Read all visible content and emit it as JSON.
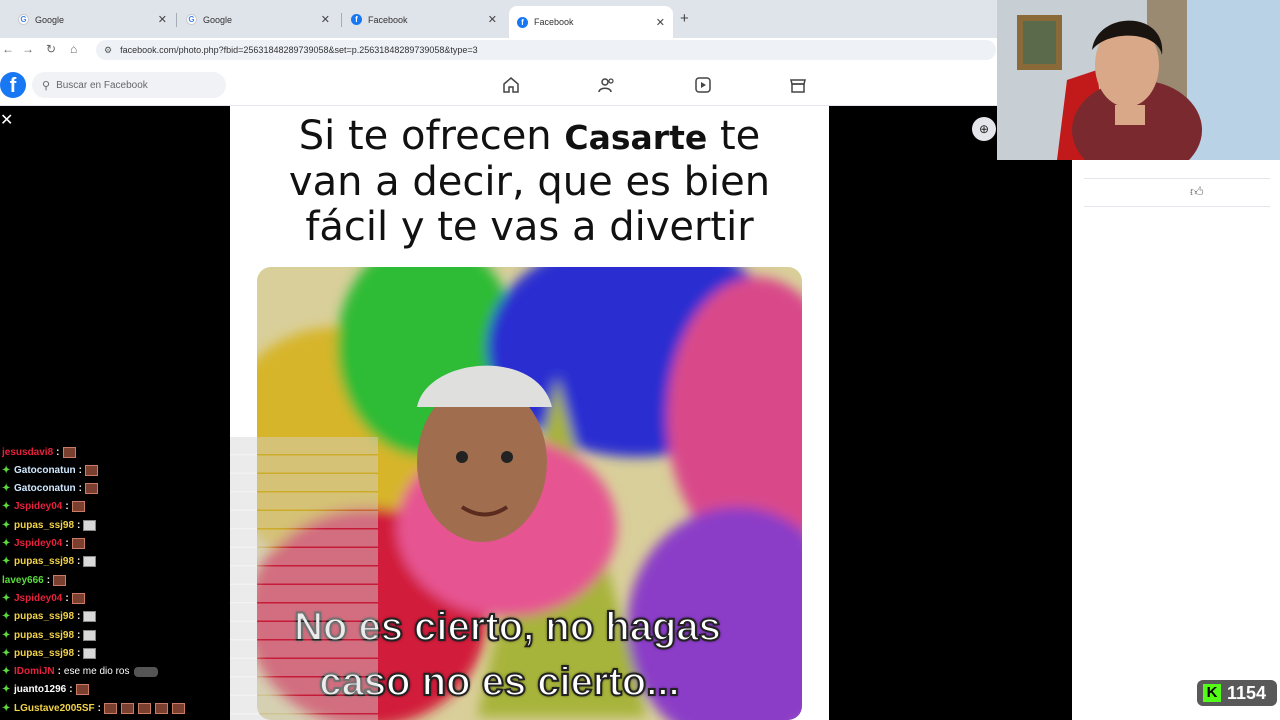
{
  "browser": {
    "tabs": [
      {
        "label": "Google",
        "favicon": "google-icon"
      },
      {
        "label": "Google",
        "favicon": "google-icon"
      },
      {
        "label": "Facebook",
        "favicon": "facebook-icon"
      },
      {
        "label": "Facebook",
        "favicon": "facebook-icon",
        "active": true
      }
    ],
    "url": "facebook.com/photo.php?fbid=2563184828973905​8&set=p.25631848289739058&type=3"
  },
  "facebook": {
    "logo": "f",
    "search_placeholder": "Buscar en Facebook",
    "nav_icons": [
      "home-icon",
      "friends-icon",
      "video-icon",
      "marketplace-icon"
    ]
  },
  "meme": {
    "caption_part1": "Si te ofrecen",
    "caption_bold": "Casarte",
    "caption_part2": "te",
    "caption_line2": "van a decir, que es bien",
    "caption_line3": "fácil y te vas a divertir",
    "subtitle_line1": "No es cierto, no hagas",
    "subtitle_line2": "caso no es cierto..."
  },
  "chat": {
    "messages": [
      {
        "user": "jesusdavi8",
        "color": "#e8213c",
        "badge": false,
        "emotes": 1
      },
      {
        "user": "Gatoconatun",
        "color": "#cfe8ff",
        "badge": true,
        "emotes": 1
      },
      {
        "user": "Gatoconatun",
        "color": "#cfe8ff",
        "badge": true,
        "emotes": 1
      },
      {
        "user": "Jspidey04",
        "color": "#e8213c",
        "badge": true,
        "emotes": 1
      },
      {
        "user": "pupas_ssj98",
        "color": "#f2d34a",
        "badge": true,
        "emotes": 1,
        "white": true
      },
      {
        "user": "Jspidey04",
        "color": "#e8213c",
        "badge": true,
        "emotes": 1
      },
      {
        "user": "pupas_ssj98",
        "color": "#f2d34a",
        "badge": true,
        "emotes": 1,
        "white": true
      },
      {
        "user": "lavey666",
        "color": "#5bdc3c",
        "badge": false,
        "emotes": 1
      },
      {
        "user": "Jspidey04",
        "color": "#e8213c",
        "badge": true,
        "emotes": 1
      },
      {
        "user": "pupas_ssj98",
        "color": "#f2d34a",
        "badge": true,
        "emotes": 1,
        "white": true
      },
      {
        "user": "pupas_ssj98",
        "color": "#f2d34a",
        "badge": true,
        "emotes": 1,
        "white": true
      },
      {
        "user": "pupas_ssj98",
        "color": "#f2d34a",
        "badge": true,
        "emotes": 1,
        "white": true
      },
      {
        "user": "IDomiJN",
        "color": "#e8213c",
        "badge": true,
        "message": "ese me dio ros",
        "car": true
      },
      {
        "user": "juanto1296",
        "color": "#ffffff",
        "badge": true,
        "emotes": 1
      },
      {
        "user": "LGustave2005SF",
        "color": "#f2d34a",
        "badge": true,
        "emotes": 5
      }
    ]
  },
  "overlay": {
    "kick_logo": "K",
    "viewer_count": "1154"
  },
  "colors": {
    "facebook_blue": "#1877f2",
    "kick_green": "#53fc18"
  }
}
